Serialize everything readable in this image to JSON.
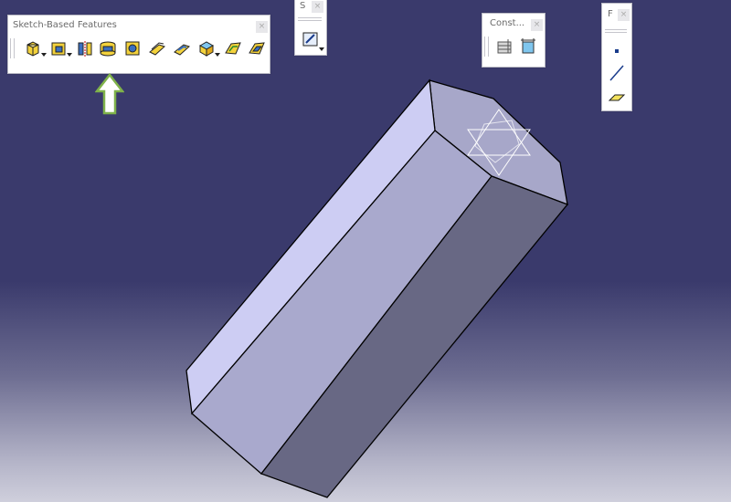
{
  "toolbars": {
    "sketch_based": {
      "title": "Sketch-Based Features",
      "close_glyph": "×",
      "buttons": [
        {
          "name": "pad-icon",
          "dropdown": true
        },
        {
          "name": "pocket-icon",
          "dropdown": true
        },
        {
          "name": "shaft-icon",
          "dropdown": false
        },
        {
          "name": "groove-icon",
          "dropdown": false
        },
        {
          "name": "hole-icon",
          "dropdown": false
        },
        {
          "name": "rib-icon",
          "dropdown": false
        },
        {
          "name": "slot-icon",
          "dropdown": false
        },
        {
          "name": "solid-combine-icon",
          "dropdown": true
        },
        {
          "name": "multi-sections-solid-icon",
          "dropdown": false
        },
        {
          "name": "removed-multi-sections-solid-icon",
          "dropdown": false
        }
      ]
    },
    "sketcher": {
      "title": "S",
      "close_glyph": "×",
      "button_icon": "sketcher-icon"
    },
    "constraint": {
      "title": "Const...",
      "close_glyph": "×",
      "buttons": [
        "constraint-defined-in-dialog-icon",
        "constraint-icon"
      ]
    },
    "reference_elements": {
      "title": "F",
      "close_glyph": "×",
      "buttons": [
        "point-icon",
        "line-icon",
        "plane-icon"
      ]
    }
  },
  "annotation": {
    "arrow": "highlight-arrow-icon",
    "points_to": "groove-icon",
    "color": "#7fb24a"
  },
  "colors": {
    "background_top": "#3a3a6c",
    "background_bottom": "#cfcfdc",
    "part_light": "#cdcdf2",
    "part_mid": "#a9a9cd",
    "part_dark": "#686884",
    "part_edges": "#000000"
  }
}
